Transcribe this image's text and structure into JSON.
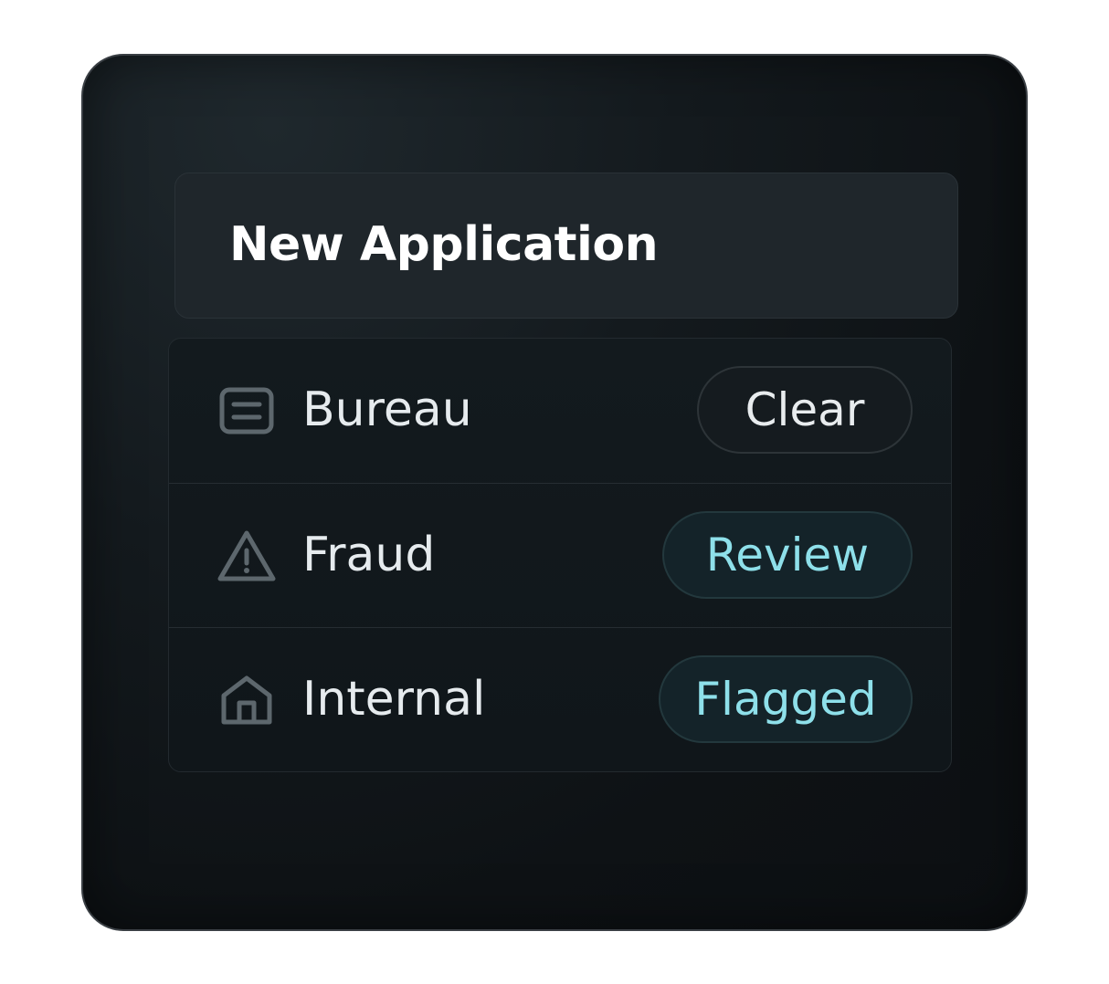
{
  "header": {
    "title": "New Application"
  },
  "checks": [
    {
      "label": "Bureau",
      "icon": "document-list-icon",
      "status": "Clear",
      "status_color": "#e8ecee"
    },
    {
      "label": "Fraud",
      "icon": "warning-triangle-icon",
      "status": "Review",
      "status_color": "#8ee0ea"
    },
    {
      "label": "Internal",
      "icon": "home-icon",
      "status": "Flagged",
      "status_color": "#8ee0ea"
    }
  ],
  "colors": {
    "background": "#0e1215",
    "panel": "#1f262b",
    "accent": "#8ee0ea",
    "icon": "#5d676d"
  }
}
